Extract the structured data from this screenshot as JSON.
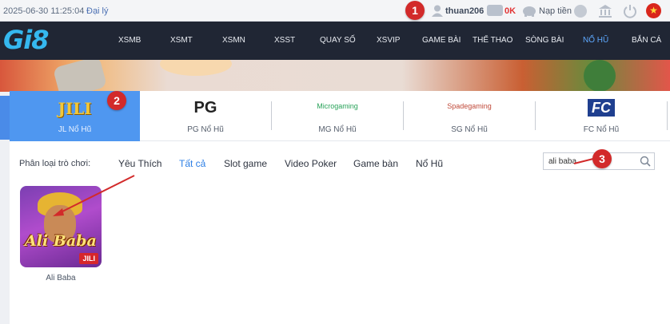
{
  "topbar": {
    "datetime": "2025-06-30 11:25:04",
    "agent_link": "Đại lý",
    "username": "thuan206",
    "balance": "0K",
    "deposit": "Nạp tiền"
  },
  "brand": {
    "logo_text": "Gi8"
  },
  "nav": {
    "items": [
      "XSMB",
      "XSMT",
      "XSMN",
      "XSST",
      "QUAY SỐ",
      "XSVIP",
      "GAME BÀI",
      "THỂ THAO",
      "SÒNG BÀI",
      "NỔ HŨ",
      "BẮN CÁ"
    ],
    "active": "NỔ HŨ"
  },
  "providers": [
    {
      "logo": "JILI",
      "label": "JL Nổ Hũ"
    },
    {
      "logo": "PG",
      "label": "PG Nổ Hũ"
    },
    {
      "logo": "Microgaming",
      "label": "MG Nổ Hũ"
    },
    {
      "logo": "Spadegaming",
      "label": "SG Nổ Hũ"
    },
    {
      "logo": "FC",
      "label": "FC Nổ Hũ"
    }
  ],
  "filter": {
    "label": "Phân loại trò chơi:",
    "categories": [
      "Yêu Thích",
      "Tất cả",
      "Slot game",
      "Video Poker",
      "Game bàn",
      "Nổ Hũ"
    ],
    "active": "Tất cả"
  },
  "search": {
    "value": "ali baba"
  },
  "games": [
    {
      "name": "Ali Baba",
      "thumb_title": "Ali Baba",
      "provider_badge": "JILI"
    }
  ],
  "markers": [
    "1",
    "2",
    "3"
  ],
  "colors": {
    "accent": "#4f97f0",
    "marker": "#d22a2a",
    "nav_bg": "#202634"
  }
}
